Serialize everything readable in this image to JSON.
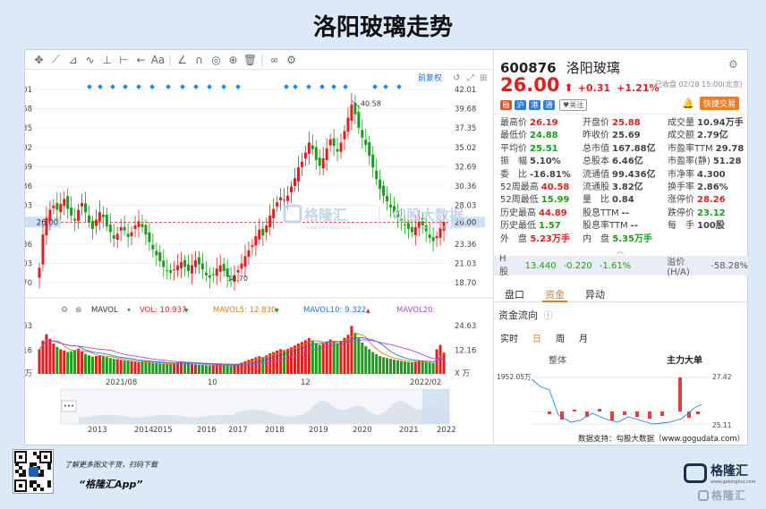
{
  "page_title": "洛阳玻璃走势",
  "toolbar": {
    "icons": [
      "move-icon",
      "line-tool-icon",
      "fork-icon",
      "wave-icon",
      "measure-icon",
      "range-icon",
      "arrow-left-icon",
      "text-icon",
      "ruler-icon",
      "magnet-icon",
      "eye-icon",
      "lock-icon",
      "trash-icon",
      "link-icon",
      "gear-icon"
    ],
    "glyphs": [
      "✥",
      "⟋",
      "⊿",
      "∿",
      "⊥",
      "⊢",
      "←",
      "Aa",
      "∠",
      "∩",
      "◎",
      "⊕",
      "🗑",
      "∞",
      "⚙"
    ]
  },
  "chart": {
    "adjust_label": "前复权",
    "y_ticks": [
      "42.01",
      "39.68",
      "37.35",
      "35.02",
      "32.69",
      "30.36",
      "28.03",
      "26.00",
      "23.36",
      "21.03",
      "18.70"
    ],
    "current_price": "26.00",
    "high_label": "40.58",
    "low_label": "18.70",
    "indicator": {
      "name": "MAVOL",
      "vol": "VOL: 10.937",
      "ma5": "MAVOL5: 12.830",
      "ma10": "MAVOL10: 9.322",
      "ma20": "MAVOL20:"
    },
    "vol_ticks": [
      "24.63",
      "12.16",
      "X 万"
    ],
    "x_labels": [
      "2021/08",
      "10",
      "12",
      "2022/02"
    ],
    "overview_years": [
      "2013",
      "2014",
      "2015",
      "2016",
      "2017",
      "2018",
      "2019",
      "2020",
      "2021",
      "2022"
    ],
    "more_label": "•••"
  },
  "chart_data": {
    "type": "candlestick",
    "title": "洛阳玻璃走势",
    "ylim": [
      18.7,
      42.01
    ],
    "y_ticks": [
      42.01,
      39.68,
      37.35,
      35.02,
      32.69,
      30.36,
      28.03,
      26.0,
      23.36,
      21.03,
      18.7
    ],
    "x_labels": [
      "2021/08",
      "10",
      "12",
      "2022/02"
    ],
    "close": [
      20.5,
      24.5,
      26.5,
      27.5,
      28.0,
      27.5,
      28.2,
      28.8,
      27.6,
      26.8,
      26.2,
      27.5,
      28.3,
      27.2,
      26.0,
      25.2,
      26.3,
      27.2,
      26.6,
      25.5,
      24.8,
      24.0,
      24.6,
      25.4,
      25.0,
      24.2,
      24.8,
      25.6,
      26.1,
      25.4,
      24.5,
      23.6,
      22.7,
      22.0,
      21.3,
      20.6,
      20.2,
      19.9,
      20.3,
      20.8,
      21.2,
      20.6,
      20.1,
      20.8,
      21.4,
      20.9,
      20.3,
      19.6,
      19.3,
      19.6,
      20.4,
      20.8,
      20.1,
      19.4,
      19.1,
      19.6,
      20.2,
      21.0,
      21.9,
      22.6,
      23.2,
      24.3,
      25.1,
      24.4,
      25.6,
      26.8,
      27.6,
      28.4,
      29.0,
      28.7,
      29.2,
      30.3,
      31.3,
      32.6,
      33.3,
      34.4,
      35.6,
      34.8,
      33.5,
      32.8,
      33.7,
      34.9,
      36.0,
      35.2,
      34.5,
      35.6,
      37.0,
      38.6,
      40.2,
      39.0,
      37.4,
      36.2,
      35.3,
      34.0,
      32.6,
      31.2,
      30.0,
      29.2,
      28.5,
      27.8,
      27.1,
      26.6,
      26.0,
      25.6,
      25.2,
      24.8,
      25.4,
      26.1,
      25.6,
      24.9,
      24.1,
      23.7,
      24.3,
      25.3,
      26.0
    ],
    "volume": [
      12.5,
      17.0,
      20.3,
      18.0,
      15.5,
      13.8,
      12.6,
      12.0,
      11.2,
      11.6,
      12.2,
      12.9,
      11.4,
      10.2,
      9.5,
      8.8,
      9.1,
      9.4,
      9.0,
      8.6,
      8.1,
      7.7,
      7.5,
      7.2,
      7.0,
      6.8,
      6.5,
      6.3,
      6.1,
      6.4,
      6.2,
      5.9,
      5.7,
      5.6,
      5.4,
      5.2,
      5.1,
      5.0,
      5.4,
      5.9,
      6.2,
      5.8,
      5.4,
      5.1,
      4.9,
      4.7,
      4.6,
      4.4,
      4.2,
      4.5,
      4.8,
      5.0,
      4.6,
      4.3,
      4.2,
      4.6,
      5.2,
      5.8,
      6.5,
      7.2,
      7.8,
      8.5,
      9.0,
      8.6,
      9.5,
      10.5,
      11.2,
      12.0,
      12.6,
      12.2,
      12.8,
      13.6,
      14.5,
      15.5,
      16.3,
      17.2,
      18.3,
      17.2,
      15.8,
      14.9,
      15.6,
      16.6,
      17.6,
      16.6,
      15.8,
      16.9,
      18.5,
      20.0,
      24.5,
      21.0,
      18.2,
      16.0,
      14.1,
      12.6,
      11.2,
      10.1,
      9.1,
      8.5,
      8.1,
      7.7,
      7.3,
      7.0,
      6.7,
      6.4,
      6.1,
      5.9,
      6.3,
      6.8,
      6.4,
      6.0,
      5.8,
      5.6,
      12.6,
      14.8,
      10.9
    ],
    "series": [
      {
        "name": "MAVOL5"
      },
      {
        "name": "MAVOL10"
      },
      {
        "name": "MAVOL20"
      }
    ],
    "overview_xlim": [
      2013,
      2022
    ]
  },
  "quote": {
    "code": "600876",
    "name": "洛阳玻璃",
    "price": "26.00",
    "arrow": "⬆",
    "change": "+0.31",
    "pct": "+1.21%",
    "status": "已收盘 02/28 15:00(北京)",
    "trade_btn": "快捷交易",
    "tags": [
      "融",
      "沪",
      "港",
      "通",
      "关注"
    ],
    "grid": [
      [
        {
          "k": "最高价",
          "v": "26.19",
          "c": "red"
        },
        {
          "k": "开盘价",
          "v": "25.88",
          "c": "red"
        },
        {
          "k": "成交量",
          "v": "10.94万手",
          "c": ""
        }
      ],
      [
        {
          "k": "最低价",
          "v": "24.88",
          "c": "green"
        },
        {
          "k": "昨收价",
          "v": "25.69",
          "c": ""
        },
        {
          "k": "成交额",
          "v": "2.79亿",
          "c": ""
        }
      ],
      [
        {
          "k": "平均价",
          "v": "25.51",
          "c": "green"
        },
        {
          "k": "总市值",
          "v": "167.88亿",
          "c": ""
        },
        {
          "k": "市盈率TTM",
          "v": "29.78",
          "c": ""
        }
      ],
      [
        {
          "k": "振　幅",
          "v": "5.10%",
          "c": ""
        },
        {
          "k": "总股本",
          "v": "6.46亿",
          "c": ""
        },
        {
          "k": "市盈率(静)",
          "v": "51.28",
          "c": ""
        }
      ],
      [
        {
          "k": "委　比",
          "v": "-16.81%",
          "c": ""
        },
        {
          "k": "流通值",
          "v": "99.436亿",
          "c": ""
        },
        {
          "k": "市净率",
          "v": "4.300",
          "c": ""
        }
      ],
      [
        {
          "k": "52周最高",
          "v": "40.58",
          "c": "red"
        },
        {
          "k": "流通股",
          "v": "3.82亿",
          "c": ""
        },
        {
          "k": "换手率",
          "v": "2.86%",
          "c": ""
        }
      ],
      [
        {
          "k": "52周最低",
          "v": "15.99",
          "c": "green"
        },
        {
          "k": "量　比",
          "v": "0.84",
          "c": ""
        },
        {
          "k": "涨停价",
          "v": "28.26",
          "c": "red"
        }
      ],
      [
        {
          "k": "历史最高",
          "v": "44.89",
          "c": "red"
        },
        {
          "k": "股息TTM",
          "v": "--",
          "c": ""
        },
        {
          "k": "跌停价",
          "v": "23.12",
          "c": "green"
        }
      ],
      [
        {
          "k": "历史最低",
          "v": "1.57",
          "c": "green"
        },
        {
          "k": "股息率TTM",
          "v": "--",
          "c": ""
        },
        {
          "k": "每　手",
          "v": "100股",
          "c": ""
        }
      ]
    ],
    "outer": {
      "k": "外　盘",
      "v": "5.23万手"
    },
    "inner": {
      "k": "内　盘",
      "v": "5.35万手"
    },
    "hshare": {
      "label": "H股",
      "price": "13.440",
      "chg": "-0.220",
      "pct": "-1.61%",
      "premium_label": "溢价(H/A)",
      "premium": "-58.28%"
    },
    "tabs": [
      "盘口",
      "资金",
      "异动"
    ],
    "fund_title": "资金流向",
    "periods": [
      "实时",
      "日",
      "周",
      "月"
    ],
    "flow_tabs": [
      "整体",
      "主力大单"
    ],
    "flow_left": "1952.05万",
    "flow_right_top": "27.42",
    "flow_right_bot": "25.11",
    "source": "数据支持：勾股大数据（www.gogudata.com）"
  },
  "watermark": {
    "main": "格隆汇",
    "sub": "www.gelonghui.com",
    "data": "勾股大数据",
    "data_sub": "www.gogudata.com"
  },
  "footer": {
    "line1": "了解更多图文干货，扫码下载",
    "line2": "“格隆汇App”",
    "logo": "格隆汇",
    "logo_sub": "www.gelonghui.com",
    "brand_btm": "格隆汇"
  },
  "colors": {
    "up": "#e02020",
    "down": "#1a9e1a",
    "accent": "#1a73e8",
    "bg": "#dce9f7"
  }
}
